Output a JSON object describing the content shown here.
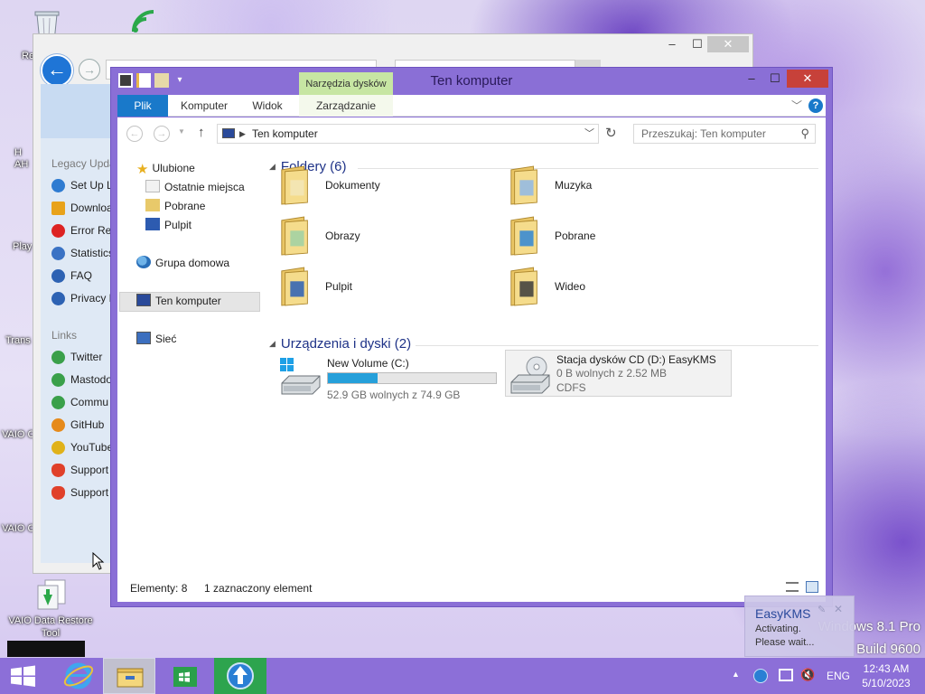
{
  "desktop": {
    "icons": [
      {
        "label": "Re",
        "icon": "recycle-bin-icon"
      },
      {
        "label": "H AH",
        "icon": "app-icon"
      },
      {
        "label": "Play",
        "icon": "app-icon"
      },
      {
        "label": "Trans",
        "icon": "app-icon"
      },
      {
        "label": "VAIO C",
        "icon": "app-icon"
      },
      {
        "label": "VAIO C",
        "icon": "app-icon"
      },
      {
        "label": "VAIO Data Restore Tool",
        "icon": "restore-tool-icon"
      }
    ],
    "watermark": {
      "line1": "Windows 8.1 Pro",
      "line2": "Build 9600"
    }
  },
  "background_window": {
    "sidebar_heading_1": "Legacy Upda",
    "items_1": [
      "Set Up L",
      "Downloa",
      "Error Re",
      "Statistics",
      "FAQ",
      "Privacy P"
    ],
    "sidebar_heading_2": "Links",
    "items_2": [
      "Twitter",
      "Mastodo",
      "Commu",
      "GitHub",
      "YouTube",
      "Support",
      "Support"
    ],
    "colors": {
      "accent": "#1f75d6"
    }
  },
  "explorer": {
    "title": "Ten komputer",
    "context_tab_header": "Narzędzia dysków",
    "tabs": [
      "Plik",
      "Komputer",
      "Widok",
      "Zarządzanie"
    ],
    "address": "Ten komputer",
    "search_placeholder": "Przeszukaj: Ten komputer",
    "nav": {
      "favorites": "Ulubione",
      "favorites_items": [
        "Ostatnie miejsca",
        "Pobrane",
        "Pulpit"
      ],
      "homegroup": "Grupa domowa",
      "this_pc": "Ten komputer",
      "network": "Sieć"
    },
    "folders_header": "Foldery (6)",
    "folders": [
      {
        "name": "Dokumenty",
        "icon": "documents-folder-icon"
      },
      {
        "name": "Muzyka",
        "icon": "music-folder-icon"
      },
      {
        "name": "Obrazy",
        "icon": "pictures-folder-icon"
      },
      {
        "name": "Pobrane",
        "icon": "downloads-folder-icon"
      },
      {
        "name": "Pulpit",
        "icon": "desktop-folder-icon"
      },
      {
        "name": "Wideo",
        "icon": "videos-folder-icon"
      }
    ],
    "drives_header": "Urządzenia i dyski (2)",
    "drives": [
      {
        "name": "New Volume (C:)",
        "free": "52.9 GB wolnych z 74.9 GB",
        "used_fraction": 0.294
      },
      {
        "name": "Stacja dysków CD (D:) EasyKMS",
        "free": "0 B wolnych z 2.52 MB",
        "fs": "CDFS"
      }
    ],
    "status": {
      "count": "Elementy: 8",
      "selected": "1 zaznaczony element"
    },
    "colors": {
      "frame": "#8a6fd6",
      "file_tab": "#1979ca",
      "context": "#c7e6a3",
      "bar": "#26a0da"
    }
  },
  "toast": {
    "title": "EasyKMS",
    "line1": "Activating.",
    "line2": "Please wait..."
  },
  "taskbar": {
    "lang": "ENG",
    "time": "12:43 AM",
    "date": "5/10/2023",
    "buttons": [
      "start-button",
      "internet-explorer",
      "file-explorer",
      "store",
      "easykms"
    ]
  }
}
